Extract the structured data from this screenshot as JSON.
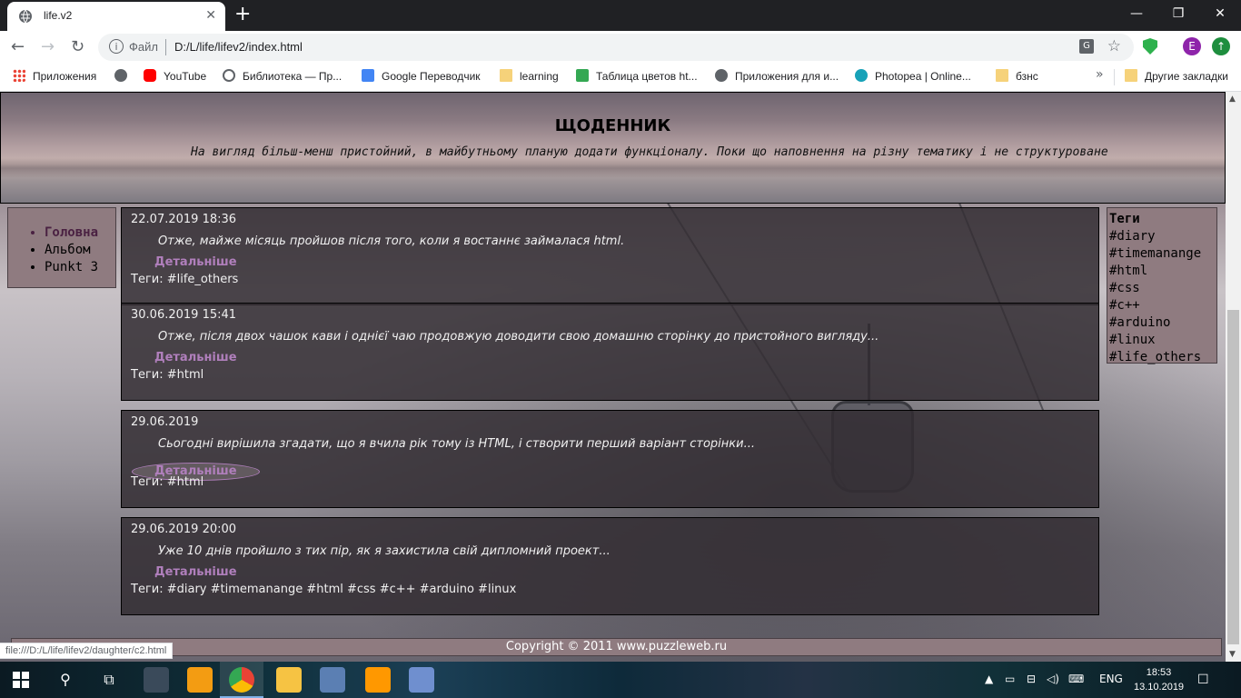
{
  "browser": {
    "tab_title": "life.v2",
    "tab_close": "✕",
    "new_tab": "+",
    "window_controls": {
      "minimize": "—",
      "restore": "❐",
      "close": "✕"
    },
    "nav": {
      "back": "←",
      "forward": "→",
      "reload": "↻"
    },
    "address": {
      "scheme_label": "Файл",
      "url": "D:/L/life/lifev2/index.html"
    },
    "profile_initial": "E",
    "update_glyph": "↑",
    "bookmarks": [
      {
        "label": "Приложения",
        "icon": "apps-grid-icon"
      },
      {
        "label": "",
        "icon": "globe-icon"
      },
      {
        "label": "YouTube",
        "icon": "youtube-icon"
      },
      {
        "label": "Библиотека — Пр...",
        "icon": "library-icon"
      },
      {
        "label": "Google Переводчик",
        "icon": "google-translate-icon"
      },
      {
        "label": "learning",
        "icon": "folder-icon"
      },
      {
        "label": "Таблица цветов ht...",
        "icon": "puzzle-icon"
      },
      {
        "label": "Приложения для и...",
        "icon": "globe-icon"
      },
      {
        "label": "Photopea | Online...",
        "icon": "photopea-icon"
      },
      {
        "label": "бзнс",
        "icon": "folder-icon"
      }
    ],
    "bookmarks_overflow": "»",
    "other_bookmarks": "Другие закладки",
    "status_url": "file:///D:/L/life/lifev2/daughter/c2.html"
  },
  "page": {
    "header": {
      "title": "ЩОДЕННИК",
      "subtitle": "На вигляд більш-менш пристойний, в майбутньому планую додати функціоналу. Поки що наповнення на різну тематику і не структуроване"
    },
    "nav_items": [
      {
        "label": "Головна",
        "active": true
      },
      {
        "label": "Альбом",
        "active": false
      },
      {
        "label": "Punkt 3",
        "active": false
      }
    ],
    "tags_panel": {
      "heading": "Теги",
      "tags": [
        "#diary",
        "#timemanange",
        "#html",
        "#css",
        "#c++",
        "#arduino",
        "#linux",
        "#life_others"
      ]
    },
    "posts": [
      {
        "date": "22.07.2019 18:36",
        "text": "Отже, майже місяць пройшов після того, коли я востаннє займалася html.",
        "more": "Детальніше",
        "tags": "Теги: #life_others"
      },
      {
        "date": "30.06.2019 15:41",
        "text": "Отже, після двох чашок кави і однієї чаю продовжую доводити свою домашню сторінку до пристойного вигляду...",
        "more": "Детальніше",
        "tags": "Теги: #html"
      },
      {
        "date": "29.06.2019",
        "text": "Сьогодні вирішила згадати, що я вчила рік тому із HTML, і створити перший варіант сторінки...",
        "more": "Детальніше",
        "tags": "Теги: #html"
      },
      {
        "date": "29.06.2019 20:00",
        "text": "Уже 10 днів пройшло з тих пір, як я захистила свій дипломний проект...",
        "more": "Детальніше",
        "tags": "Теги: #diary #timemanange #html #css #c++ #arduino #linux"
      }
    ],
    "footer": "Copyright © 2011 www.puzzleweb.ru"
  },
  "taskbar": {
    "apps": [
      "nfs-icon",
      "video-player-icon",
      "chrome-icon",
      "file-explorer-icon",
      "search-tool-icon",
      "sublime-text-icon",
      "paint-icon"
    ],
    "language": "ENG",
    "time": "18:53",
    "date": "13.10.2019"
  },
  "colors": {
    "panel_bg": "#8f7b80",
    "post_bg": "#322d32",
    "link": "#b07fbc",
    "active_nav": "#4a2142"
  }
}
